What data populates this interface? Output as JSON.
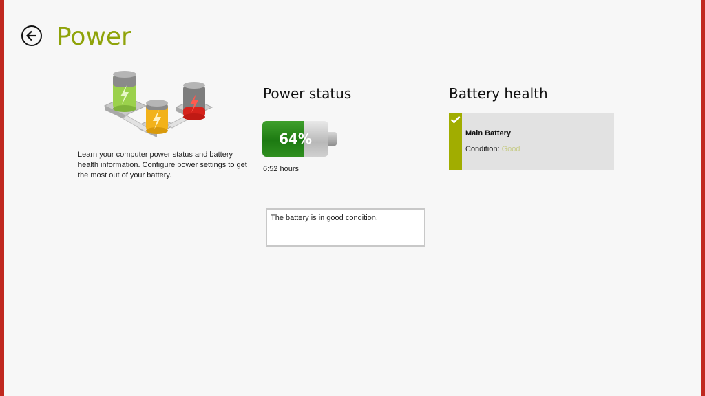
{
  "page": {
    "title": "Power",
    "description": "Learn your computer power status and battery health information.  Configure power settings to get the most out of your battery."
  },
  "power_status": {
    "heading": "Power status",
    "charge_percent": 64,
    "charge_label": "64%",
    "time_remaining": "6:52 hours",
    "status_message": "The battery is in good condition."
  },
  "battery_health": {
    "heading": "Battery health",
    "cards": [
      {
        "name": "Main Battery",
        "condition_label": "Condition:",
        "condition_value": "Good"
      }
    ]
  },
  "icons": {
    "back": "back-arrow-icon",
    "check": "check-icon",
    "illustration": "batteries-illustration-icon"
  },
  "colors": {
    "accent": "#8fa30a",
    "card_accent": "#a1ad00",
    "frame": "#c0281f",
    "charge_green": "#2f8f1f"
  }
}
